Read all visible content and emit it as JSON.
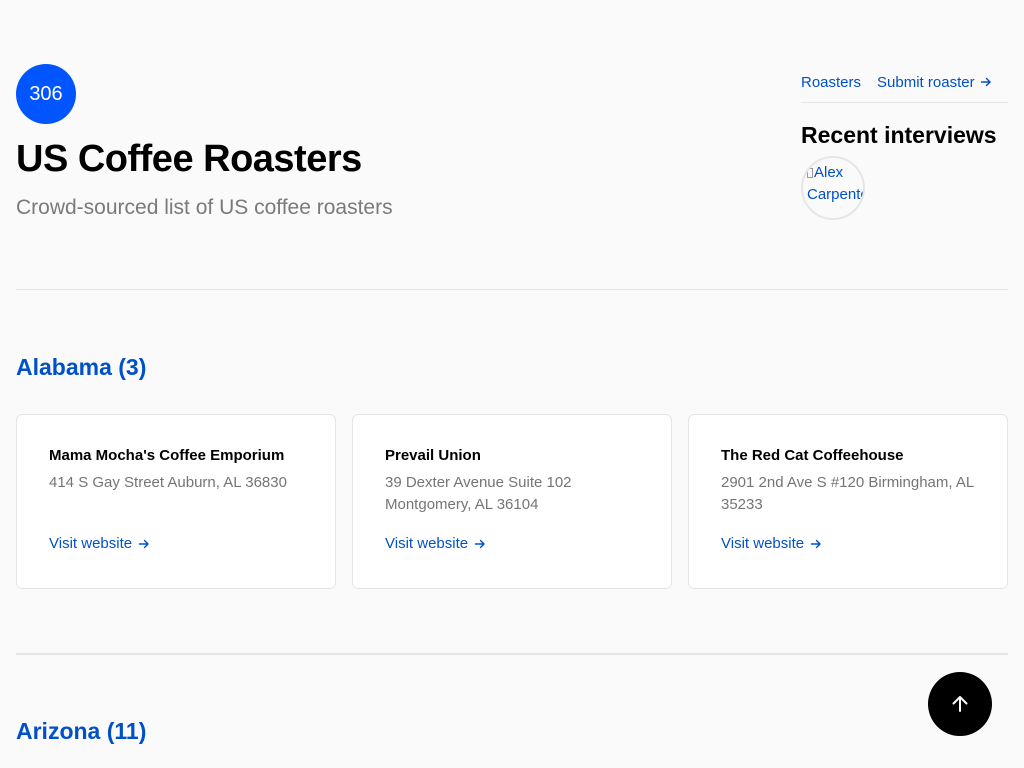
{
  "header": {
    "count": "306",
    "title": "US Coffee Roasters",
    "subtitle": "Crowd-sourced list of US coffee roasters"
  },
  "nav": {
    "roasters": "Roasters",
    "submit": "Submit roaster"
  },
  "recent": {
    "title": "Recent interviews",
    "avatar_alt": "Alex Carpenter"
  },
  "sections": [
    {
      "heading": "Alabama (3)",
      "roasters": [
        {
          "name": "Mama Mocha's Coffee Emporium",
          "address": "414 S Gay Street Auburn, AL 36830",
          "link": "Visit website"
        },
        {
          "name": "Prevail Union",
          "address": "39 Dexter Avenue Suite 102 Montgomery, AL 36104",
          "link": "Visit website"
        },
        {
          "name": "The Red Cat Coffeehouse",
          "address": "2901 2nd Ave S #120 Birmingham, AL 35233",
          "link": "Visit website"
        }
      ]
    },
    {
      "heading": "Arizona (11)"
    }
  ],
  "colors": {
    "accent": "#0055ff",
    "link": "#0051c8",
    "background": "#fafafa"
  },
  "icons": {
    "link_arrow": "arrow-right-icon",
    "scroll_top": "arrow-up-icon"
  }
}
